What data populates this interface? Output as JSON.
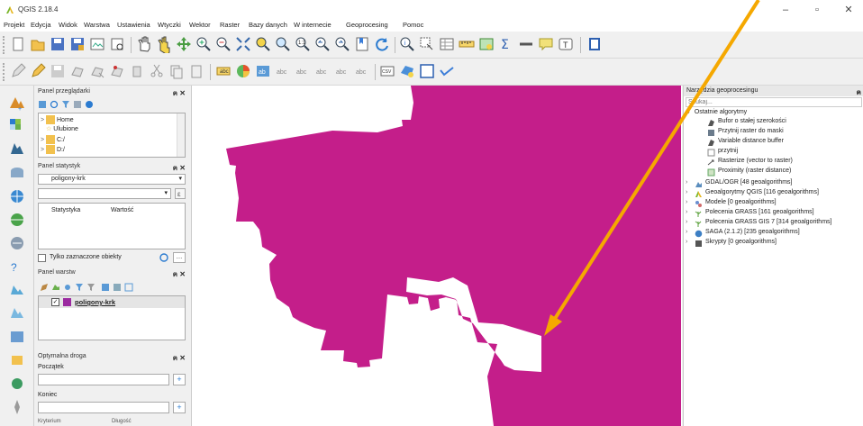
{
  "window": {
    "title": "QGIS 2.18.4",
    "minimize": "–",
    "maximize": "▫",
    "close": "✕"
  },
  "menu": [
    "Projekt",
    "Edycja",
    "Widok",
    "Warstwa",
    "Ustawienia",
    "Wtyczki",
    "Wektor",
    "Raster",
    "Bazy danych",
    "W internecie",
    "Geoprocesing",
    "Pomoc"
  ],
  "browser_panel": {
    "title": "Panel przeglądarki",
    "controls": "ฅ ✕",
    "items": [
      "Home",
      "Ulubione",
      "C:/",
      "D:/"
    ]
  },
  "stats_panel": {
    "title": "Panel statystyk",
    "controls": "ฅ ✕",
    "layer_select": "poligony-krk",
    "field_select": "",
    "col_statistic": "Statystyka",
    "col_value": "Wartość",
    "selected_only_label": "Tylko zaznaczone obiekty"
  },
  "layers_panel": {
    "title": "Panel warstw",
    "controls": "ฅ ✕",
    "layer_name": "poligony-krk"
  },
  "route_panel": {
    "title": "Optymalna droga",
    "controls": "ฅ ✕",
    "start_label": "Początek",
    "end_label": "Koniec",
    "start_value": "",
    "end_value": "",
    "bottom_left": "Kryterium",
    "bottom_right": "Długość"
  },
  "processing_panel": {
    "title": "Narzędzia geoprocesingu",
    "search_placeholder": "Szukaj...",
    "recent_group": "Ostatnie algorytmy",
    "recent": [
      "Bufor o stałej szerokości",
      "Przytnij raster do maski",
      "Variable distance buffer",
      "przytnij",
      "Rasterize (vector to raster)",
      "Proximity (raster distance)"
    ],
    "providers": [
      "GDAL/OGR [48 geoalgorithms]",
      "Geoalgorytmy QGIS [116 geoalgorithms]",
      "Modele [0 geoalgorithms]",
      "Polecenia GRASS [161 geoalgorithms]",
      "Polecenia GRASS GIS 7 [314 geoalgorithms]",
      "SAGA (2.1.2) [235 geoalgorithms]",
      "Skrypty [0 geoalgorithms]"
    ]
  },
  "colors": {
    "polygon_fill": "#c41e8a",
    "annotation_arrow": "#f5a800",
    "layer_swatch": "#9b2aa0"
  }
}
